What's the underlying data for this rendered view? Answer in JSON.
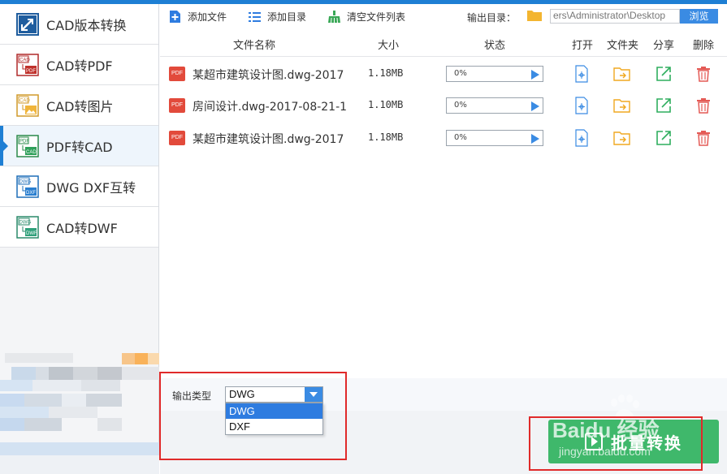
{
  "sidebar": {
    "items": [
      {
        "label": "CAD版本转换",
        "icon": "cad-version-convert-icon",
        "active": false
      },
      {
        "label": "CAD转PDF",
        "icon": "cad-to-pdf-icon",
        "active": false
      },
      {
        "label": "CAD转图片",
        "icon": "cad-to-image-icon",
        "active": false
      },
      {
        "label": "PDF转CAD",
        "icon": "pdf-to-cad-icon",
        "active": true
      },
      {
        "label": "DWG DXF互转",
        "icon": "dwg-dxf-convert-icon",
        "active": false
      },
      {
        "label": "CAD转DWF",
        "icon": "cad-to-dwf-icon",
        "active": false
      }
    ]
  },
  "toolbar": {
    "add_file": "添加文件",
    "add_folder": "添加目录",
    "clear_list": "清空文件列表",
    "output_dir_label": "输出目录：",
    "output_path": "ers\\Administrator\\Desktop",
    "browse": "浏览"
  },
  "table": {
    "headers": {
      "name": "文件名称",
      "size": "大小",
      "status": "状态",
      "open": "打开",
      "folder": "文件夹",
      "share": "分享",
      "delete": "删除"
    },
    "rows": [
      {
        "badge": "PDF",
        "name": "某超市建筑设计图.dwg-2017",
        "size": "1.18MB",
        "progress": "0%",
        "progress_value": 0
      },
      {
        "badge": "PDF",
        "name": "房间设计.dwg-2017-08-21-1",
        "size": "1.10MB",
        "progress": "0%",
        "progress_value": 0
      },
      {
        "badge": "PDF",
        "name": "某超市建筑设计图.dwg-2017",
        "size": "1.18MB",
        "progress": "0%",
        "progress_value": 0
      }
    ]
  },
  "output": {
    "type_label": "输出类型",
    "selected": "DWG",
    "options": [
      "DWG",
      "DXF"
    ]
  },
  "batch_button": "批量转换",
  "watermark": {
    "line1": "Baidu 经验",
    "line2": "jingyan.baidu.com"
  },
  "colors": {
    "accent": "#1e7fd4",
    "button_blue": "#3a8be3",
    "batch_green": "#3fb86b",
    "pdf_red": "#e24a3b",
    "highlight_red": "#e02a2a"
  }
}
